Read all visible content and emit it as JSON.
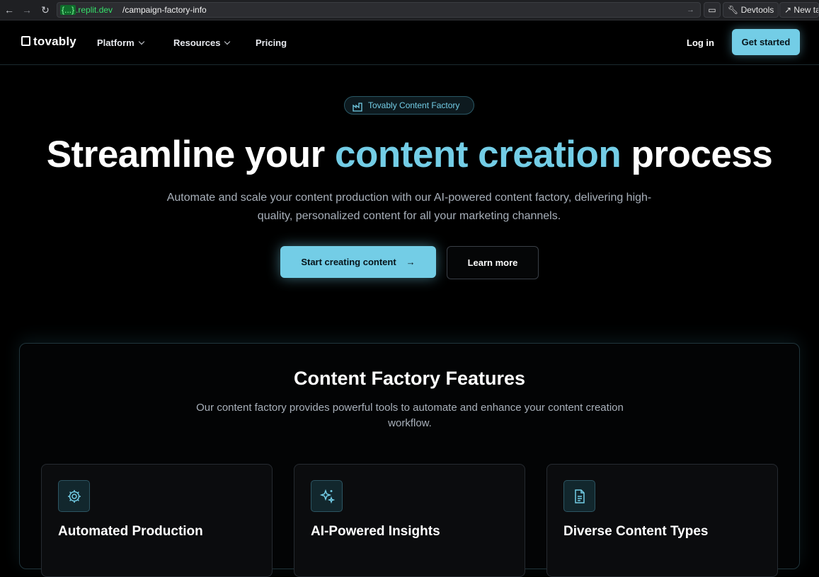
{
  "browser": {
    "host_brace": "{...}",
    "host_domain": ".replit.dev",
    "path": "/campaign-factory-info",
    "devtools_label": "Devtools",
    "newtab_label": "New ta"
  },
  "nav": {
    "logo": "tovably",
    "items": [
      {
        "label": "Platform"
      },
      {
        "label": "Resources"
      },
      {
        "label": "Pricing"
      }
    ],
    "login": "Log in",
    "get_started": "Get started"
  },
  "hero": {
    "badge": "Tovably Content Factory",
    "title_pre": "Streamline your ",
    "title_accent": "content creation",
    "title_post": " process",
    "subtitle": "Automate and scale your content production with our AI-powered content factory, delivering high-quality, personalized content for all your marketing channels.",
    "primary_button": "Start creating content",
    "secondary_button": "Learn more"
  },
  "features": {
    "title": "Content Factory Features",
    "subtitle": "Our content factory provides powerful tools to automate and enhance your content creation workflow.",
    "cards": [
      {
        "title": "Automated Production",
        "icon": "gear-icon"
      },
      {
        "title": "AI-Powered Insights",
        "icon": "sparkles-icon"
      },
      {
        "title": "Diverse Content Types",
        "icon": "document-icon"
      }
    ]
  },
  "colors": {
    "accent": "#73cde6",
    "background": "#000000"
  }
}
